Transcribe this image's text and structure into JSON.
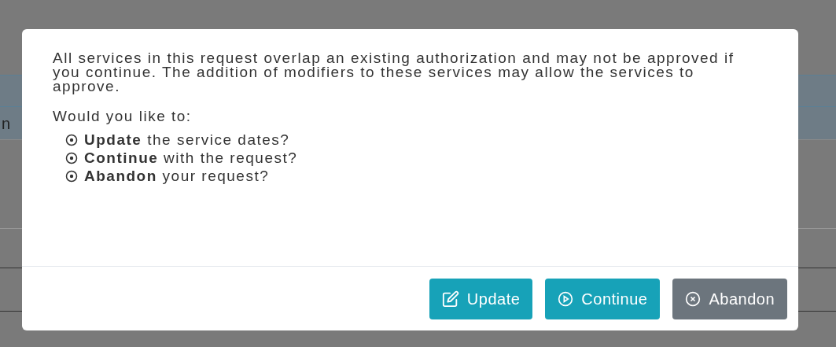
{
  "background": {
    "cut_text": "n"
  },
  "dialog": {
    "message": "All services in this request overlap an existing authorization and may not be approved if you continue. The addition of modifiers to these services may allow the services to approve.",
    "question": "Would you like to:",
    "options": [
      "**Update** the service dates?",
      "**Continue** with the request?",
      "**Abandon** your request?"
    ],
    "buttons": [
      {
        "label": "Update",
        "kind": "edit"
      },
      {
        "label": "Continue",
        "kind": "play"
      },
      {
        "label": "Abandon",
        "kind": "cancel"
      }
    ]
  }
}
